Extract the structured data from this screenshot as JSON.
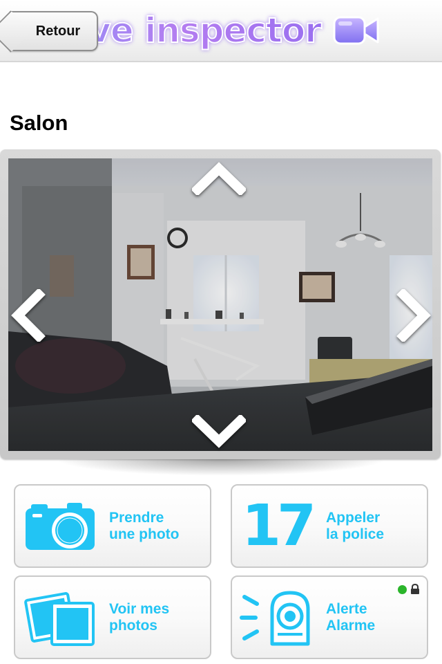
{
  "header": {
    "back_label": "Retour",
    "brand": "live inspector"
  },
  "page": {
    "title": "Salon"
  },
  "camera": {
    "controls": [
      "pan-up",
      "pan-down",
      "pan-left",
      "pan-right"
    ]
  },
  "actions": {
    "photo": {
      "label": "Prendre\nune photo",
      "icon": "camera-icon"
    },
    "police": {
      "label": "Appeler\nla police",
      "icon_text": "17"
    },
    "gallery": {
      "label": "Voir mes\nphotos",
      "icon": "photos-icon"
    },
    "alarm": {
      "label": "Alerte\nAlarme",
      "icon": "alarm-sensor-icon",
      "status": "armed-locked"
    }
  },
  "colors": {
    "accent": "#22c4f4",
    "brand_purple": "#a07cf0",
    "status_green": "#2bb52b"
  }
}
